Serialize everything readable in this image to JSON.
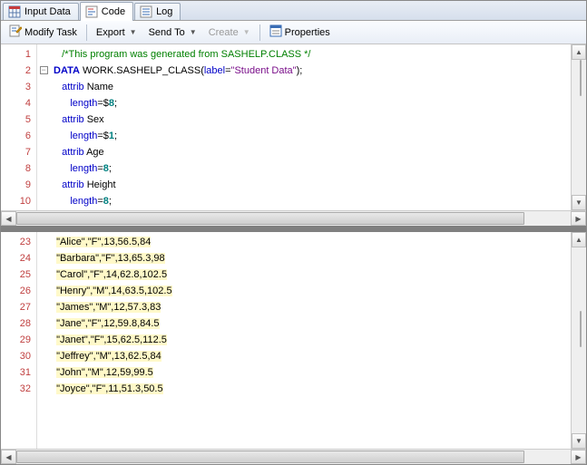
{
  "tabs": [
    {
      "label": "Input Data"
    },
    {
      "label": "Code"
    },
    {
      "label": "Log"
    }
  ],
  "toolbar": {
    "modify": "Modify Task",
    "export": "Export",
    "sendto": "Send To",
    "create": "Create",
    "properties": "Properties"
  },
  "top_code": {
    "start_line": 1,
    "lines": [
      {
        "n": 1,
        "tokens": [
          {
            "t": "   ",
            "c": ""
          },
          {
            "t": "/*This program was generated from SASHELP.CLASS */",
            "c": "c-comment"
          }
        ]
      },
      {
        "n": 2,
        "fold": true,
        "tokens": [
          {
            "t": "DATA",
            "c": "c-keyword"
          },
          {
            "t": " WORK.SASHELP_CLASS(",
            "c": "c-plain"
          },
          {
            "t": "label",
            "c": "c-attrib"
          },
          {
            "t": "=",
            "c": "c-plain"
          },
          {
            "t": "\"Student Data\"",
            "c": "c-string"
          },
          {
            "t": ");",
            "c": "c-plain"
          }
        ]
      },
      {
        "n": 3,
        "tokens": [
          {
            "t": "   ",
            "c": ""
          },
          {
            "t": "attrib",
            "c": "c-attrib"
          },
          {
            "t": " Name",
            "c": "c-plain"
          }
        ]
      },
      {
        "n": 4,
        "tokens": [
          {
            "t": "      ",
            "c": ""
          },
          {
            "t": "length",
            "c": "c-attrib"
          },
          {
            "t": "=$",
            "c": "c-plain"
          },
          {
            "t": "8",
            "c": "c-num"
          },
          {
            "t": ";",
            "c": "c-plain"
          }
        ]
      },
      {
        "n": 5,
        "tokens": [
          {
            "t": "   ",
            "c": ""
          },
          {
            "t": "attrib",
            "c": "c-attrib"
          },
          {
            "t": " Sex",
            "c": "c-plain"
          }
        ]
      },
      {
        "n": 6,
        "tokens": [
          {
            "t": "      ",
            "c": ""
          },
          {
            "t": "length",
            "c": "c-attrib"
          },
          {
            "t": "=$",
            "c": "c-plain"
          },
          {
            "t": "1",
            "c": "c-num"
          },
          {
            "t": ";",
            "c": "c-plain"
          }
        ]
      },
      {
        "n": 7,
        "tokens": [
          {
            "t": "   ",
            "c": ""
          },
          {
            "t": "attrib",
            "c": "c-attrib"
          },
          {
            "t": " Age",
            "c": "c-plain"
          }
        ]
      },
      {
        "n": 8,
        "tokens": [
          {
            "t": "      ",
            "c": ""
          },
          {
            "t": "length",
            "c": "c-attrib"
          },
          {
            "t": "=",
            "c": "c-plain"
          },
          {
            "t": "8",
            "c": "c-num"
          },
          {
            "t": ";",
            "c": "c-plain"
          }
        ]
      },
      {
        "n": 9,
        "tokens": [
          {
            "t": "   ",
            "c": ""
          },
          {
            "t": "attrib",
            "c": "c-attrib"
          },
          {
            "t": " Height",
            "c": "c-plain"
          }
        ]
      },
      {
        "n": 10,
        "tokens": [
          {
            "t": "      ",
            "c": ""
          },
          {
            "t": "length",
            "c": "c-attrib"
          },
          {
            "t": "=",
            "c": "c-plain"
          },
          {
            "t": "8",
            "c": "c-num"
          },
          {
            "t": ";",
            "c": "c-plain"
          }
        ]
      }
    ]
  },
  "bottom_code": {
    "lines": [
      {
        "n": 23,
        "data": "\"Alice\",\"F\",13,56.5,84"
      },
      {
        "n": 24,
        "data": "\"Barbara\",\"F\",13,65.3,98"
      },
      {
        "n": 25,
        "data": "\"Carol\",\"F\",14,62.8,102.5"
      },
      {
        "n": 26,
        "data": "\"Henry\",\"M\",14,63.5,102.5"
      },
      {
        "n": 27,
        "data": "\"James\",\"M\",12,57.3,83"
      },
      {
        "n": 28,
        "data": "\"Jane\",\"F\",12,59.8,84.5"
      },
      {
        "n": 29,
        "data": "\"Janet\",\"F\",15,62.5,112.5"
      },
      {
        "n": 30,
        "data": "\"Jeffrey\",\"M\",13,62.5,84"
      },
      {
        "n": 31,
        "data": "\"John\",\"M\",12,59,99.5"
      },
      {
        "n": 32,
        "data": "\"Joyce\",\"F\",11,51.3,50.5"
      }
    ]
  }
}
